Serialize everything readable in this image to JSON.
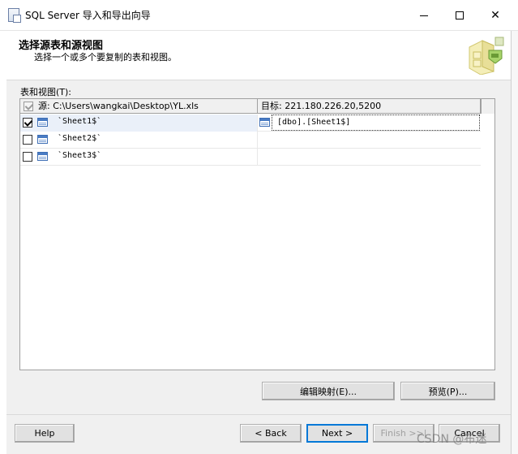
{
  "window": {
    "title": "SQL Server 导入和导出向导",
    "minimize": "—",
    "maximize": "☐",
    "close": "✕"
  },
  "header": {
    "title": "选择源表和源视图",
    "subtitle": "选择一个或多个要复制的表和视图。",
    "logo_icon": "wizard-logo-icon"
  },
  "grid": {
    "label": "表和视图(T):",
    "columns": {
      "source": "源: C:\\Users\\wangkai\\Desktop\\YL.xls",
      "destination": "目标: 221.180.226.20,5200"
    },
    "rows": [
      {
        "source": "`Sheet1$`",
        "checked": true,
        "destination": "[dbo].[Sheet1$]"
      },
      {
        "source": "`Sheet2$`",
        "checked": false,
        "destination": ""
      },
      {
        "source": "`Sheet3$`",
        "checked": false,
        "destination": ""
      }
    ]
  },
  "buttons": {
    "edit_mappings": "编辑映射(E)...",
    "preview": "预览(P)...",
    "help": "Help",
    "back": "< Back",
    "next": "Next >",
    "finish": "Finish >>|",
    "cancel": "Cancel"
  },
  "watermark": "CSDN @布迷",
  "colors": {
    "focus_border": "#0078d7",
    "table_icon": "#4a7cc4",
    "dialog_bg": "#f0f0f0"
  }
}
